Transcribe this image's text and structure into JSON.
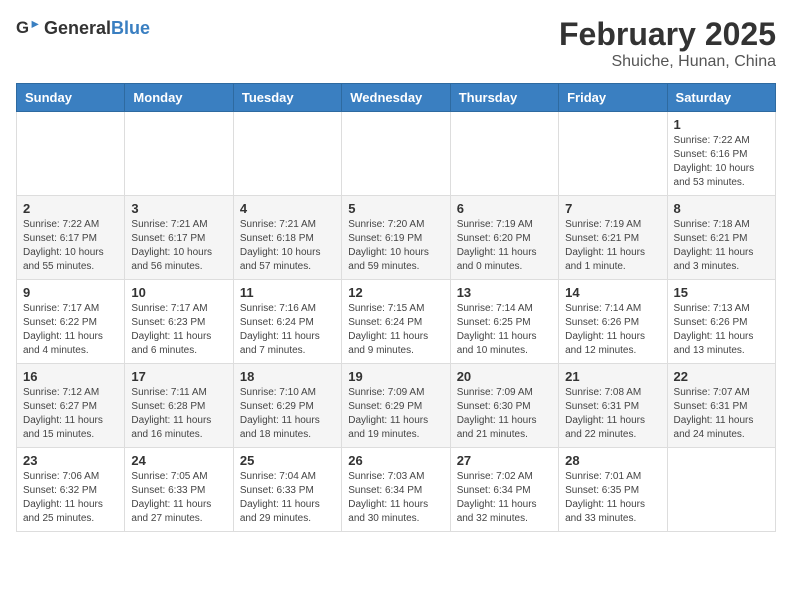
{
  "header": {
    "logo_general": "General",
    "logo_blue": "Blue",
    "month": "February 2025",
    "location": "Shuiche, Hunan, China"
  },
  "weekdays": [
    "Sunday",
    "Monday",
    "Tuesday",
    "Wednesday",
    "Thursday",
    "Friday",
    "Saturday"
  ],
  "weeks": [
    [
      {
        "day": "",
        "info": ""
      },
      {
        "day": "",
        "info": ""
      },
      {
        "day": "",
        "info": ""
      },
      {
        "day": "",
        "info": ""
      },
      {
        "day": "",
        "info": ""
      },
      {
        "day": "",
        "info": ""
      },
      {
        "day": "1",
        "info": "Sunrise: 7:22 AM\nSunset: 6:16 PM\nDaylight: 10 hours\nand 53 minutes."
      }
    ],
    [
      {
        "day": "2",
        "info": "Sunrise: 7:22 AM\nSunset: 6:17 PM\nDaylight: 10 hours\nand 55 minutes."
      },
      {
        "day": "3",
        "info": "Sunrise: 7:21 AM\nSunset: 6:17 PM\nDaylight: 10 hours\nand 56 minutes."
      },
      {
        "day": "4",
        "info": "Sunrise: 7:21 AM\nSunset: 6:18 PM\nDaylight: 10 hours\nand 57 minutes."
      },
      {
        "day": "5",
        "info": "Sunrise: 7:20 AM\nSunset: 6:19 PM\nDaylight: 10 hours\nand 59 minutes."
      },
      {
        "day": "6",
        "info": "Sunrise: 7:19 AM\nSunset: 6:20 PM\nDaylight: 11 hours\nand 0 minutes."
      },
      {
        "day": "7",
        "info": "Sunrise: 7:19 AM\nSunset: 6:21 PM\nDaylight: 11 hours\nand 1 minute."
      },
      {
        "day": "8",
        "info": "Sunrise: 7:18 AM\nSunset: 6:21 PM\nDaylight: 11 hours\nand 3 minutes."
      }
    ],
    [
      {
        "day": "9",
        "info": "Sunrise: 7:17 AM\nSunset: 6:22 PM\nDaylight: 11 hours\nand 4 minutes."
      },
      {
        "day": "10",
        "info": "Sunrise: 7:17 AM\nSunset: 6:23 PM\nDaylight: 11 hours\nand 6 minutes."
      },
      {
        "day": "11",
        "info": "Sunrise: 7:16 AM\nSunset: 6:24 PM\nDaylight: 11 hours\nand 7 minutes."
      },
      {
        "day": "12",
        "info": "Sunrise: 7:15 AM\nSunset: 6:24 PM\nDaylight: 11 hours\nand 9 minutes."
      },
      {
        "day": "13",
        "info": "Sunrise: 7:14 AM\nSunset: 6:25 PM\nDaylight: 11 hours\nand 10 minutes."
      },
      {
        "day": "14",
        "info": "Sunrise: 7:14 AM\nSunset: 6:26 PM\nDaylight: 11 hours\nand 12 minutes."
      },
      {
        "day": "15",
        "info": "Sunrise: 7:13 AM\nSunset: 6:26 PM\nDaylight: 11 hours\nand 13 minutes."
      }
    ],
    [
      {
        "day": "16",
        "info": "Sunrise: 7:12 AM\nSunset: 6:27 PM\nDaylight: 11 hours\nand 15 minutes."
      },
      {
        "day": "17",
        "info": "Sunrise: 7:11 AM\nSunset: 6:28 PM\nDaylight: 11 hours\nand 16 minutes."
      },
      {
        "day": "18",
        "info": "Sunrise: 7:10 AM\nSunset: 6:29 PM\nDaylight: 11 hours\nand 18 minutes."
      },
      {
        "day": "19",
        "info": "Sunrise: 7:09 AM\nSunset: 6:29 PM\nDaylight: 11 hours\nand 19 minutes."
      },
      {
        "day": "20",
        "info": "Sunrise: 7:09 AM\nSunset: 6:30 PM\nDaylight: 11 hours\nand 21 minutes."
      },
      {
        "day": "21",
        "info": "Sunrise: 7:08 AM\nSunset: 6:31 PM\nDaylight: 11 hours\nand 22 minutes."
      },
      {
        "day": "22",
        "info": "Sunrise: 7:07 AM\nSunset: 6:31 PM\nDaylight: 11 hours\nand 24 minutes."
      }
    ],
    [
      {
        "day": "23",
        "info": "Sunrise: 7:06 AM\nSunset: 6:32 PM\nDaylight: 11 hours\nand 25 minutes."
      },
      {
        "day": "24",
        "info": "Sunrise: 7:05 AM\nSunset: 6:33 PM\nDaylight: 11 hours\nand 27 minutes."
      },
      {
        "day": "25",
        "info": "Sunrise: 7:04 AM\nSunset: 6:33 PM\nDaylight: 11 hours\nand 29 minutes."
      },
      {
        "day": "26",
        "info": "Sunrise: 7:03 AM\nSunset: 6:34 PM\nDaylight: 11 hours\nand 30 minutes."
      },
      {
        "day": "27",
        "info": "Sunrise: 7:02 AM\nSunset: 6:34 PM\nDaylight: 11 hours\nand 32 minutes."
      },
      {
        "day": "28",
        "info": "Sunrise: 7:01 AM\nSunset: 6:35 PM\nDaylight: 11 hours\nand 33 minutes."
      },
      {
        "day": "",
        "info": ""
      }
    ]
  ]
}
